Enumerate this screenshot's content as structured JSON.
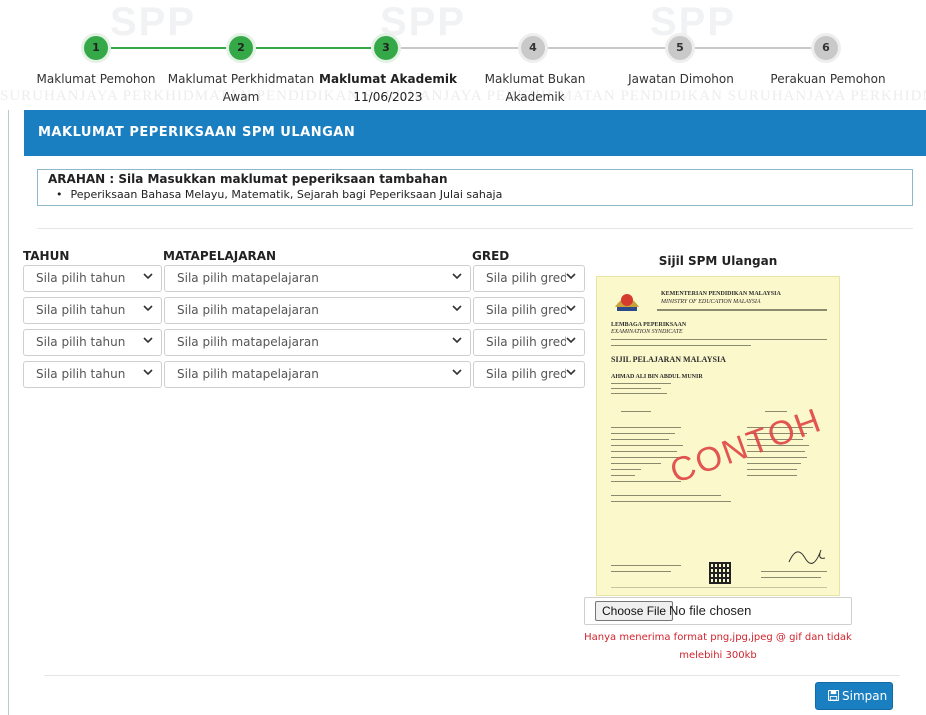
{
  "watermark": {
    "band_text": "SURUHANJAYA PERKHIDMATAN PENDIDIKAN   SURUHANJAYA PERKHIDMATAN PENDIDIKAN   SURUHANJAYA PERKHIDMATAN PENDIDIKAN   SURUI",
    "logo_text": "SPP"
  },
  "stepper": {
    "steps": [
      {
        "number": "1",
        "label": "Maklumat Pemohon",
        "status": "done"
      },
      {
        "number": "2",
        "label": "Maklumat Perkhidmatan",
        "label2": "Awam",
        "status": "done"
      },
      {
        "number": "3",
        "label": "Maklumat Akademik",
        "label2": "11/06/2023",
        "status": "current"
      },
      {
        "number": "4",
        "label": "Maklumat Bukan Akademik",
        "status": "todo"
      },
      {
        "number": "5",
        "label": "Jawatan Dimohon",
        "status": "todo"
      },
      {
        "number": "6",
        "label": "Perakuan Pemohon",
        "status": "todo"
      }
    ],
    "colors": {
      "done": "#35a847",
      "todo": "#c9c9c9"
    }
  },
  "section": {
    "title": "MAKLUMAT PEPERIKSAAN SPM ULANGAN",
    "header_color": "#1a7fc1"
  },
  "instruction": {
    "title": "ARAHAN : Sila Masukkan maklumat peperiksaan tambahan",
    "bullet": "Peperiksaan Bahasa Melayu, Matematik, Sejarah bagi Peperiksaan Julai sahaja"
  },
  "form": {
    "headers": {
      "year": "TAHUN",
      "subject": "MATAPELAJARAN",
      "grade": "GRED"
    },
    "rows": [
      {
        "year": "Sila pilih tahun",
        "subject": "Sila pilih matapelajaran",
        "grade": "Sila pilih gred"
      },
      {
        "year": "Sila pilih tahun",
        "subject": "Sila pilih matapelajaran",
        "grade": "Sila pilih gred"
      },
      {
        "year": "Sila pilih tahun",
        "subject": "Sila pilih matapelajaran",
        "grade": "Sila pilih gred"
      },
      {
        "year": "Sila pilih tahun",
        "subject": "Sila pilih matapelajaran",
        "grade": "Sila pilih gred"
      }
    ]
  },
  "certificate": {
    "title": "Sijil SPM Ulangan",
    "ministry": "KEMENTERIAN PENDIDIKAN MALAYSIA",
    "ministry_en": "MINISTRY OF EDUCATION MALAYSIA",
    "board": "LEMBAGA PEPERIKSAAN",
    "board_en": "EXAMINATION SYNDICATE",
    "cert_name": "SIJIL PELAJARAN MALAYSIA",
    "candidate": "AHMAD ALI BIN ABDUL MUNIR",
    "stamp": "CONTOH"
  },
  "upload": {
    "button_label": "Choose File",
    "status": "No file chosen",
    "note": "Hanya menerima format png,jpg,jpeg @ gif dan tidak melebihi 300kb"
  },
  "actions": {
    "save_label": "Simpan"
  }
}
